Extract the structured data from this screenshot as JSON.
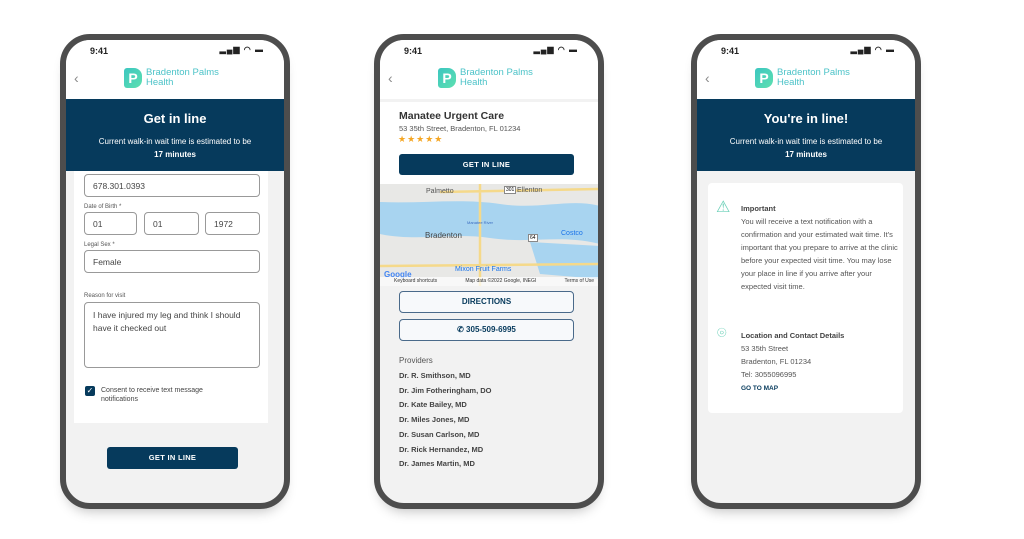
{
  "status": {
    "time": "9:41"
  },
  "brand": {
    "line1": "Bradenton Palms",
    "line2": "Health",
    "mark": "P"
  },
  "screen1": {
    "title": "Get in line",
    "wait_text": "Current walk-in wait time is estimated to be",
    "wait_value": "17 minutes",
    "phone": "678.301.0393",
    "dob_label": "Date of Birth *",
    "dob_month": "01",
    "dob_day": "01",
    "dob_year": "1972",
    "sex_label": "Legal Sex *",
    "sex_value": "Female",
    "reason_label": "Reason for visit",
    "reason_value": "I have injured my leg and think I should have it checked out",
    "consent_label": "Consent to receive text message notifications",
    "consent_checked": true,
    "button": "GET IN LINE"
  },
  "screen2": {
    "name": "Manatee Urgent Care",
    "address": "53 35th Street, Bradenton, FL 01234",
    "rating": 5,
    "button": "GET IN LINE",
    "map": {
      "labels": [
        "Palmetto",
        "Ellenton",
        "Bradenton",
        "Costco",
        "Manatee River",
        "Mixon Fruit Farms",
        "301",
        "64"
      ],
      "footer": [
        "Keyboard shortcuts",
        "Map data ©2022 Google, INEGI",
        "Terms of Use"
      ],
      "google": "Google"
    },
    "directions": "DIRECTIONS",
    "phone": "305-509-6995",
    "providers_label": "Providers",
    "providers": [
      "Dr. R. Smithson, MD",
      "Dr. Jim Fotheringham, DO",
      "Dr. Kate Bailey, MD",
      "Dr. Miles Jones, MD",
      "Dr. Susan Carlson, MD",
      "Dr. Rick Hernandez, MD",
      "Dr. James Martin, MD"
    ]
  },
  "screen3": {
    "title": "You're in line!",
    "wait_text": "Current walk-in wait time is estimated to be",
    "wait_value": "17 minutes",
    "important_title": "Important",
    "important_text": "You will receive a text notification with a confirmation and your estimated wait time. It's important that you prepare to arrive at the clinic before your expected visit time. You may lose your place in line if you arrive after your expected visit time.",
    "location_title": "Location and Contact Details",
    "street": "53 35th Street",
    "city": "Bradenton, FL 01234",
    "tel": "Tel: 3055096995",
    "map_link": "GO TO MAP"
  },
  "colors": {
    "navy": "#063a5c",
    "teal": "#4cc3c8",
    "star": "#f5a623"
  }
}
